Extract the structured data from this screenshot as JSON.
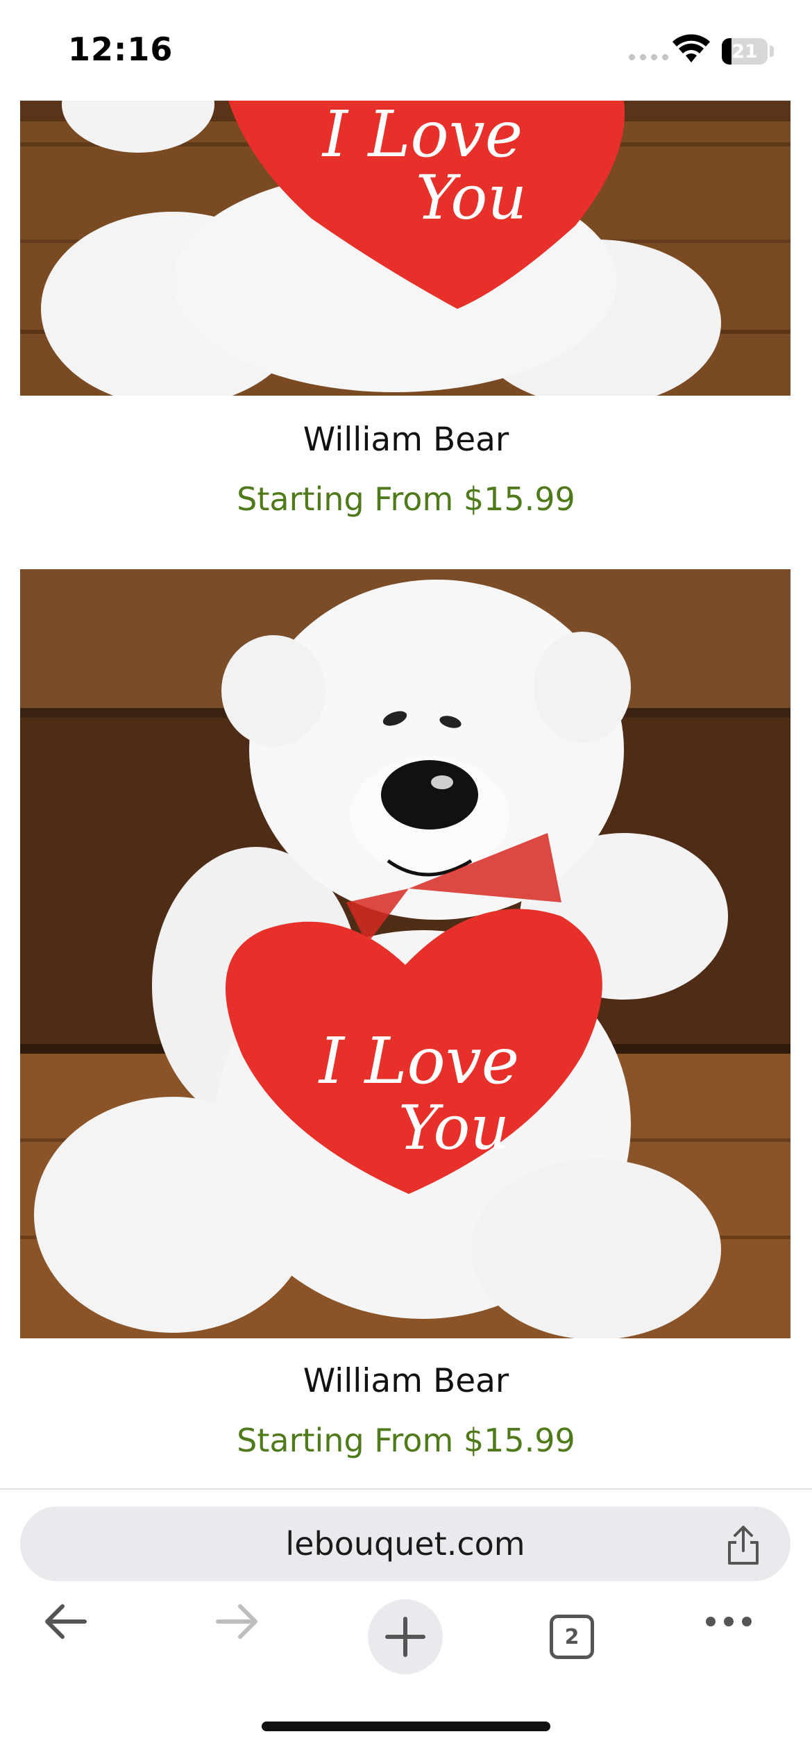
{
  "status_bar": {
    "time": "12:16",
    "battery": "21"
  },
  "products": [
    {
      "name": "William Bear",
      "price": "Starting From $15.99",
      "image_text_line1": "I Love",
      "image_text_line2": "You"
    },
    {
      "name": "William Bear",
      "price": "Starting From $15.99",
      "image_text_line1": "I Love",
      "image_text_line2": "You"
    }
  ],
  "browser": {
    "url": "lebouquet.com",
    "tab_count": "2"
  },
  "colors": {
    "price_green": "#4e7a1a",
    "address_bg": "#e8eaed",
    "heart_red": "#e8302a",
    "wood": "#7a4a22"
  },
  "icons": [
    "wifi-icon",
    "battery-icon",
    "share-icon",
    "back-arrow-icon",
    "forward-arrow-icon",
    "new-tab-plus-icon",
    "tabs-icon",
    "more-icon"
  ]
}
